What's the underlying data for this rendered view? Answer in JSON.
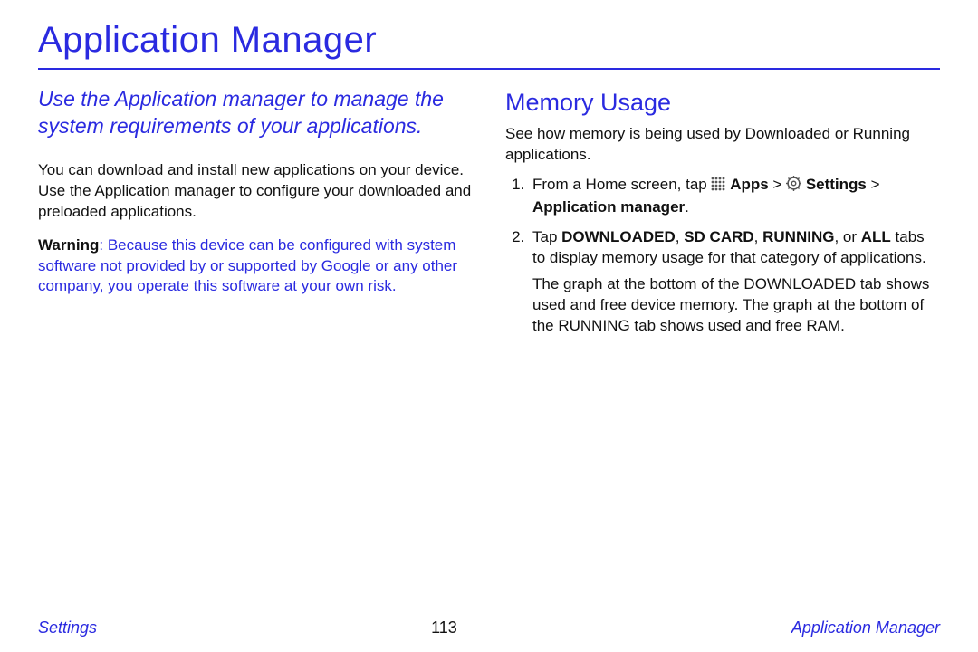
{
  "title": "Application Manager",
  "left": {
    "intro": "Use the Application manager to manage the system requirements of your applications.",
    "para1": "You can download and install new applications on your device. Use the Application manager to configure your downloaded and preloaded applications.",
    "warning_label": "Warning",
    "warning_body": ": Because this device can be configured with system software not provided by or supported by Google or any other company, you operate this software at your own risk."
  },
  "right": {
    "heading": "Memory Usage",
    "lead": "See how memory is being used by Downloaded or Running applications.",
    "step1_pre": "From a Home screen, tap ",
    "apps_label": "Apps",
    "gt": " > ",
    "settings_label": "Settings",
    "step1_post_gt": " > ",
    "appmgr_label": "Application manager",
    "period": ".",
    "step2_pre": "Tap ",
    "tab_downloaded": "DOWNLOADED",
    "comma_sp": ", ",
    "tab_sdcard": "SD CARD",
    "tab_running": "RUNNING",
    "or_sp": ", or ",
    "tab_all": "ALL",
    "step2_post": " tabs to display memory usage for that category of applications.",
    "graph_para": "The graph at the bottom of the DOWNLOADED tab shows used and free device memory. The graph at the bottom of the RUNNING tab shows used and free RAM."
  },
  "footer": {
    "left": "Settings",
    "center": "113",
    "right": "Application Manager"
  }
}
